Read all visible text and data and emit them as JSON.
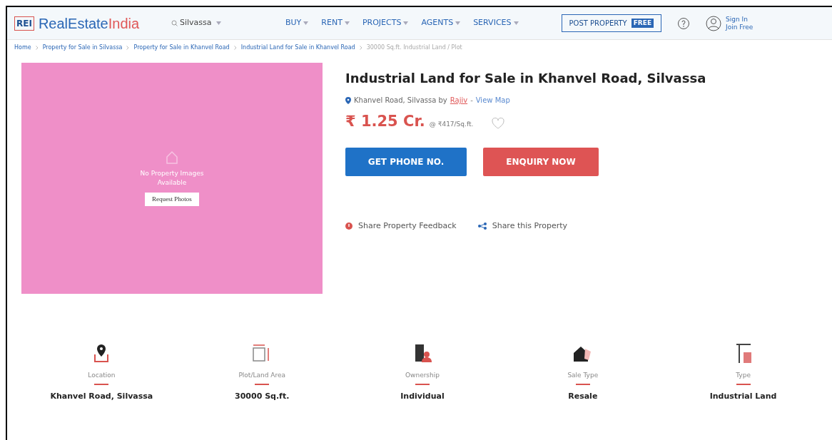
{
  "header": {
    "logo_badge": "REI",
    "logo_a": "RealEstate",
    "logo_b": "India",
    "city": "Silvassa",
    "nav": [
      "BUY",
      "RENT",
      "PROJECTS",
      "AGENTS",
      "SERVICES"
    ],
    "post_button": "POST PROPERTY",
    "post_badge": "FREE",
    "sign_in": "Sign In",
    "join": "Join Free"
  },
  "breadcrumb": [
    "Home",
    "Property for Sale in Silvassa",
    "Property for Sale in Khanvel Road",
    "Industrial Land for Sale in Khanvel Road",
    "30000 Sq.ft. Industrial Land / Plot"
  ],
  "gallery": {
    "message": "No Property Images Available",
    "button": "Request Photos"
  },
  "listing": {
    "title": "Industrial Land for Sale in Khanvel Road, Silvassa",
    "location": "Khanvel Road, Silvassa by",
    "agent": "Rajiv",
    "separator": "-",
    "map_link": "View Map",
    "price": "₹ 1.25 Cr.",
    "rate": "@ ₹417/Sq.ft.",
    "phone_button": "GET PHONE NO.",
    "enquiry_button": "ENQUIRY NOW",
    "feedback": "Share Property Feedback",
    "share": "Share this Property"
  },
  "facts": [
    {
      "kind": "location",
      "label": "Location",
      "value": "Khanvel Road, Silvassa"
    },
    {
      "kind": "area",
      "label": "Plot/Land Area",
      "value": "30000 Sq.ft."
    },
    {
      "kind": "ownership",
      "label": "Ownership",
      "value": "Individual"
    },
    {
      "kind": "sale",
      "label": "Sale Type",
      "value": "Resale"
    },
    {
      "kind": "type",
      "label": "Type",
      "value": "Industrial Land"
    }
  ]
}
